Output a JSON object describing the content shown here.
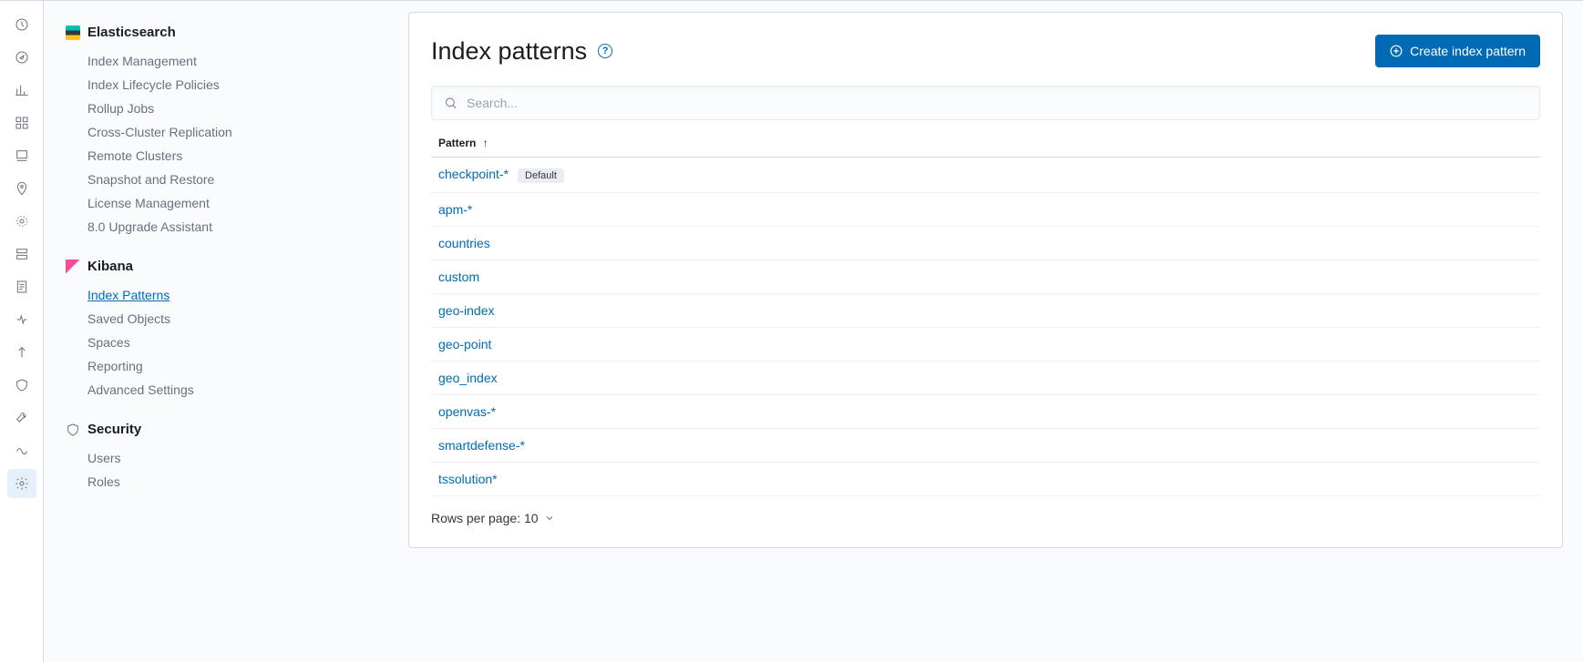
{
  "icon_rail": [
    "recent",
    "discover",
    "visualize",
    "dashboard",
    "canvas",
    "maps",
    "ml",
    "infrastructure",
    "logs",
    "apm",
    "uptime",
    "siem",
    "devtools",
    "monitoring",
    "management"
  ],
  "sidebar": {
    "groups": [
      {
        "key": "elasticsearch",
        "label": "Elasticsearch",
        "items": [
          {
            "label": "Index Management"
          },
          {
            "label": "Index Lifecycle Policies"
          },
          {
            "label": "Rollup Jobs"
          },
          {
            "label": "Cross-Cluster Replication"
          },
          {
            "label": "Remote Clusters"
          },
          {
            "label": "Snapshot and Restore"
          },
          {
            "label": "License Management"
          },
          {
            "label": "8.0 Upgrade Assistant"
          }
        ]
      },
      {
        "key": "kibana",
        "label": "Kibana",
        "items": [
          {
            "label": "Index Patterns",
            "active": true
          },
          {
            "label": "Saved Objects"
          },
          {
            "label": "Spaces"
          },
          {
            "label": "Reporting"
          },
          {
            "label": "Advanced Settings"
          }
        ]
      },
      {
        "key": "security",
        "label": "Security",
        "items": [
          {
            "label": "Users"
          },
          {
            "label": "Roles"
          }
        ]
      }
    ]
  },
  "page": {
    "title": "Index patterns",
    "create_button": "Create index pattern",
    "search_placeholder": "Search...",
    "column_header": "Pattern",
    "sort_dir": "asc",
    "default_badge": "Default",
    "rows": [
      {
        "name": "checkpoint-*",
        "default": true
      },
      {
        "name": "apm-*"
      },
      {
        "name": "countries"
      },
      {
        "name": "custom"
      },
      {
        "name": "geo-index"
      },
      {
        "name": "geo-point"
      },
      {
        "name": "geo_index"
      },
      {
        "name": "openvas-*"
      },
      {
        "name": "smartdefense-*"
      },
      {
        "name": "tssolution*"
      }
    ],
    "pager_prefix": "Rows per page: ",
    "pager_value": "10"
  }
}
